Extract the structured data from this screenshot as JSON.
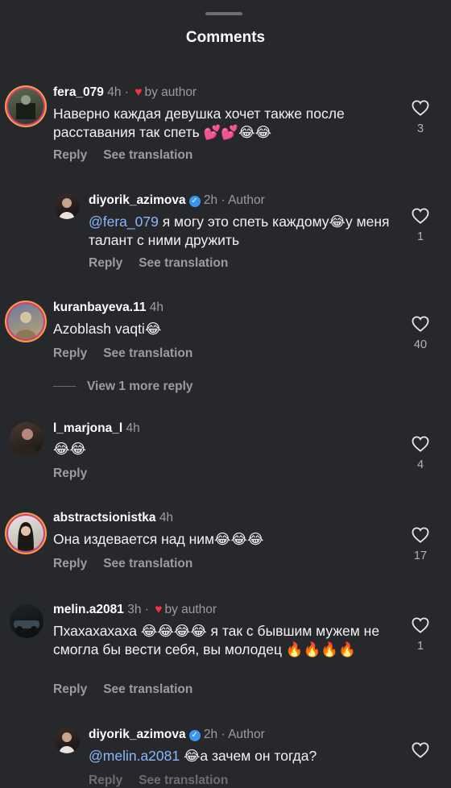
{
  "header": {
    "title": "Comments"
  },
  "actions": {
    "reply": "Reply",
    "see_translation": "See translation"
  },
  "comments": [
    {
      "user": "fera_079",
      "time": "4h",
      "author_liked": true,
      "liked_label": "by author",
      "text": "Наверно каждая девушка хочет также после расставания так спеть 💕💕😂😂",
      "likes": "3"
    },
    {
      "user": "diyorik_azimova",
      "time": "2h",
      "verified": true,
      "role": "Author",
      "mention": "@fera_079",
      "text": " я могу это спеть каждому😂у меня талант с ними дружить",
      "likes": "1"
    },
    {
      "user": "kuranbayeva.11",
      "time": "4h",
      "text": "Azoblash vaqti😂",
      "likes": "40"
    },
    {
      "user": "l_marjona_l",
      "time": "4h",
      "text": "😂😂",
      "likes": "4"
    },
    {
      "user": "abstractsionistka",
      "time": "4h",
      "text": "Она издевается над ним😂😂😂",
      "likes": "17"
    },
    {
      "user": "melin.a2081",
      "time": "3h",
      "author_liked": true,
      "liked_label": "by author",
      "text": "Пхахахахаха 😂😂😂😂 я так с бывшим мужем не смогла бы вести себя, вы молодец 🔥🔥🔥🔥",
      "likes": "1"
    },
    {
      "user": "diyorik_azimova",
      "time": "2h",
      "verified": true,
      "role": "Author",
      "mention": "@melin.a2081",
      "text": " 😂а зачем он тогда?"
    }
  ],
  "view_more": "View 1 more reply",
  "colors": {
    "background": "#27282c",
    "mention": "#8bb7ff",
    "heart": "#ff3040",
    "verified": "#3897f0"
  }
}
